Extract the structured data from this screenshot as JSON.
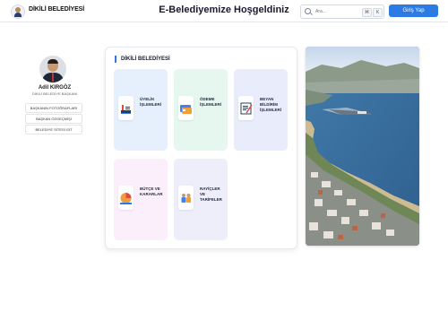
{
  "header": {
    "brand": "DİKİLİ BELEDİYESİ",
    "title": "E-Belediyemize Hoşgeldiniz",
    "search": {
      "placeholder": "Ara...",
      "shortcut_mod": "⌘",
      "shortcut_key": "K"
    },
    "login_label": "Giriş Yap"
  },
  "profile": {
    "name": "Adil KIRGÖZ",
    "role": "DİKİLİ BELEDİYE BAŞKANI",
    "links": [
      "BAŞKANIN FOTOĞRAFLARI",
      "BAŞKAN ÖZGEÇMİŞİ",
      "BELEDİYE SİTESİ GİT"
    ]
  },
  "panel": {
    "title": "DİKİLİ BELEDİYESİ",
    "cards": [
      {
        "label": "ÜYELİK\nİŞLEMLERİ",
        "icon": "membership-icon",
        "bg": "#e6f0fc"
      },
      {
        "label": "ÖDEME\nİŞLEMLERİ",
        "icon": "payment-card-icon",
        "bg": "#e5f7ef"
      },
      {
        "label": "BEYAN\nBİLDİRİM\nİŞLEMLERİ",
        "icon": "declaration-form-icon",
        "bg": "#e9edfb"
      },
      {
        "label": "BÜTÇE VE\nKARARLAR",
        "icon": "budget-chart-icon",
        "bg": "#fbeffb"
      },
      {
        "label": "RAYİÇLER\nVE\nTARİFELER",
        "icon": "tariff-people-icon",
        "bg": "#eeeefa"
      }
    ]
  },
  "colors": {
    "accent": "#2c7be5",
    "header_border": "#e6e8ee"
  }
}
